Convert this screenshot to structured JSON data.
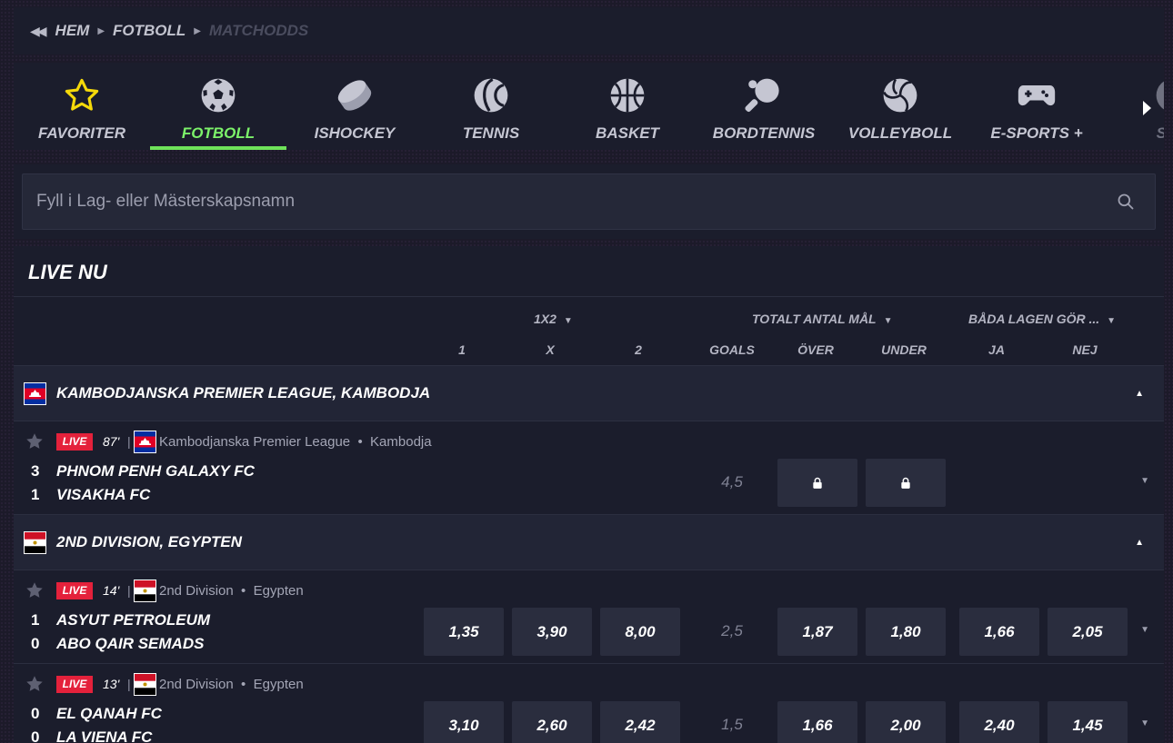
{
  "breadcrumb": {
    "back_icon": "double-left-arrow",
    "items": [
      "HEM",
      "FOTBOLL",
      "MATCHODDS"
    ]
  },
  "sports": {
    "tabs": [
      {
        "label": "FAVORITER",
        "icon": "star-icon"
      },
      {
        "label": "FOTBOLL",
        "icon": "soccer-ball-icon",
        "active": true
      },
      {
        "label": "ISHOCKEY",
        "icon": "hockey-puck-icon"
      },
      {
        "label": "TENNIS",
        "icon": "tennis-ball-icon"
      },
      {
        "label": "BASKET",
        "icon": "basketball-icon"
      },
      {
        "label": "BORDTENNIS",
        "icon": "table-tennis-icon"
      },
      {
        "label": "VOLLEYBOLL",
        "icon": "volleyball-icon"
      },
      {
        "label": "E-SPORTS +",
        "icon": "gamepad-icon"
      },
      {
        "label": "SNO",
        "icon": "snooker-icon"
      }
    ]
  },
  "search": {
    "placeholder": "Fyll i Lag- eller Mästerskapsnamn",
    "value": ""
  },
  "live": {
    "title": "LIVE NU",
    "markets": {
      "m1x2": "1X2",
      "total": "TOTALT ANTAL MÅL",
      "btts": "BÅDA LAGEN GÖR ..."
    },
    "columns": {
      "c1": "1",
      "cx": "X",
      "c2": "2",
      "goals": "GOALS",
      "over": "ÖVER",
      "under": "UNDER",
      "ja": "JA",
      "nej": "NEJ"
    },
    "leagues": [
      {
        "name": "KAMBODJANSKA PREMIER LEAGUE, KAMBODJA",
        "flag": "cambodia",
        "matches": [
          {
            "live_label": "LIVE",
            "minute": "87'",
            "league": "Kambodjanska Premier League",
            "country": "Kambodja",
            "home": {
              "score": "3",
              "name": "PHNOM PENH GALAXY FC"
            },
            "away": {
              "score": "1",
              "name": "VISAKHA FC"
            },
            "goals_line": "4,5",
            "over": "locked",
            "under": "locked"
          }
        ]
      },
      {
        "name": "2ND DIVISION, EGYPTEN",
        "flag": "egypt",
        "matches": [
          {
            "live_label": "LIVE",
            "minute": "14'",
            "league": "2nd Division",
            "country": "Egypten",
            "home": {
              "score": "1",
              "name": "ASYUT PETROLEUM"
            },
            "away": {
              "score": "0",
              "name": "ABO QAIR SEMADS"
            },
            "odds": {
              "o1": "1,35",
              "ox": "3,90",
              "o2": "8,00"
            },
            "goals_line": "2,5",
            "over": "1,87",
            "under": "1,80",
            "ja": "1,66",
            "nej": "2,05"
          },
          {
            "live_label": "LIVE",
            "minute": "13'",
            "league": "2nd Division",
            "country": "Egypten",
            "home": {
              "score": "0",
              "name": "EL QANAH FC"
            },
            "away": {
              "score": "0",
              "name": "LA VIENA FC"
            },
            "odds": {
              "o1": "3,10",
              "ox": "2,60",
              "o2": "2,42"
            },
            "goals_line": "1,5",
            "over": "1,66",
            "under": "2,00",
            "ja": "2,40",
            "nej": "1,45"
          }
        ]
      }
    ]
  },
  "colors": {
    "accent": "#6fe35a",
    "live_badge": "#e4213b",
    "panel": "#1b1d2c",
    "odds_button": "#2a2d3e"
  }
}
